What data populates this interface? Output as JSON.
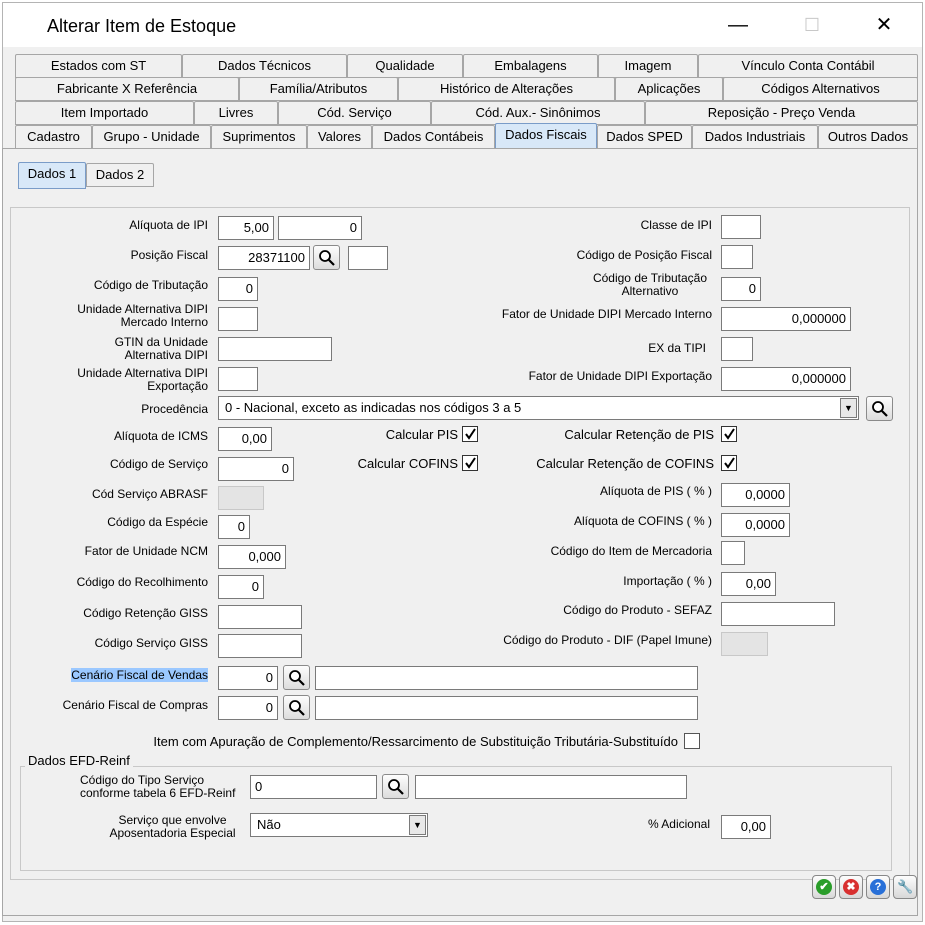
{
  "window": {
    "title": "Alterar Item de Estoque",
    "minimize": "—",
    "maximize": "☐",
    "close": "✕"
  },
  "tabs": {
    "row1": [
      "Estados com ST",
      "Dados Técnicos",
      "Qualidade",
      "Embalagens",
      "Imagem",
      "Vínculo Conta Contábil"
    ],
    "row2": [
      "Fabricante X Referência",
      "Família/Atributos",
      "Histórico de Alterações",
      "Aplicações",
      "Códigos Alternativos"
    ],
    "row3": [
      "Item Importado",
      "Livres",
      "Cód. Serviço",
      "Cód. Aux.- Sinônimos",
      "Reposição - Preço Venda"
    ],
    "row4": [
      "Cadastro",
      "Grupo - Unidade",
      "Suprimentos",
      "Valores",
      "Dados Contábeis",
      "Dados Fiscais",
      "Dados SPED",
      "Dados Industriais",
      "Outros Dados"
    ],
    "active": "Dados Fiscais"
  },
  "subtabs": [
    "Dados 1",
    "Dados 2"
  ],
  "form": {
    "aliquota_ipi": {
      "label": "Alíquota de IPI",
      "value1": "5,00",
      "value2": "0"
    },
    "classe_ipi": {
      "label": "Classe de IPI",
      "value": ""
    },
    "posicao_fiscal": {
      "label": "Posição Fiscal",
      "value": "28371100",
      "extra": ""
    },
    "codigo_posicao_fiscal": {
      "label": "Código de Posição Fiscal",
      "value": ""
    },
    "codigo_tributacao": {
      "label": "Código de Tributação",
      "value": "0"
    },
    "codigo_tributacao_alt": {
      "label": "Código de Tributação Alternativo",
      "value": "0"
    },
    "unidade_alt_dipi_mi": {
      "label": "Unidade Alternativa DIPI Mercado Interno",
      "value": ""
    },
    "fator_unidade_dipi_mi": {
      "label": "Fator de Unidade DIPI Mercado Interno",
      "value": "0,000000"
    },
    "gtin_unidade_alt": {
      "label": "GTIN da Unidade Alternativa DIPI",
      "value": ""
    },
    "ex_tipi": {
      "label": "EX da TIPI",
      "value": ""
    },
    "unidade_alt_dipi_exp": {
      "label": "Unidade Alternativa DIPI Exportação",
      "value": ""
    },
    "fator_unidade_dipi_exp": {
      "label": "Fator de Unidade DIPI Exportação",
      "value": "0,000000"
    },
    "procedencia": {
      "label": "Procedência",
      "value": "0 - Nacional, exceto as indicadas nos códigos 3 a 5"
    },
    "aliquota_icms": {
      "label": "Alíquota de ICMS",
      "value": "0,00"
    },
    "calcular_pis": {
      "label": "Calcular PIS",
      "checked": true
    },
    "calcular_retencao_pis": {
      "label": "Calcular Retenção de PIS",
      "checked": true
    },
    "codigo_servico": {
      "label": "Código de Serviço",
      "value": "0"
    },
    "calcular_cofins": {
      "label": "Calcular COFINS",
      "checked": true
    },
    "calcular_retencao_cofins": {
      "label": "Calcular Retenção de COFINS",
      "checked": true
    },
    "cod_servico_abrasf": {
      "label": "Cód Serviço ABRASF",
      "value": ""
    },
    "aliquota_pis": {
      "label": "Alíquota de PIS   ( % )",
      "value": "0,0000"
    },
    "codigo_especie": {
      "label": "Código da Espécie",
      "value": "0"
    },
    "aliquota_cofins": {
      "label": "Alíquota de COFINS ( % )",
      "value": "0,0000"
    },
    "fator_unidade_ncm": {
      "label": "Fator de Unidade NCM",
      "value": "0,000"
    },
    "codigo_item_mercadoria": {
      "label": "Código do Item de Mercadoria",
      "value": ""
    },
    "codigo_recolhimento": {
      "label": "Código do Recolhimento",
      "value": "0"
    },
    "importacao": {
      "label": "Importação ( % )",
      "value": "0,00"
    },
    "codigo_retencao_giss": {
      "label": "Código Retenção GISS",
      "value": ""
    },
    "codigo_produto_sefaz": {
      "label": "Código do Produto - SEFAZ",
      "value": ""
    },
    "codigo_servico_giss": {
      "label": "Código Serviço GISS",
      "value": ""
    },
    "codigo_produto_dif": {
      "label": "Código do Produto - DIF (Papel Imune)",
      "value": ""
    },
    "cenario_vendas": {
      "label": "Cenário Fiscal de Vendas",
      "value": "0",
      "desc": ""
    },
    "cenario_compras": {
      "label": "Cenário Fiscal de Compras",
      "value": "0",
      "desc": ""
    },
    "item_apuracao": {
      "label": "Item com Apuração de Complemento/Ressarcimento de Substituição Tributária-Substituído",
      "checked": false
    }
  },
  "efd_reinf": {
    "title": "Dados EFD-Reinf",
    "codigo_tipo_servico": {
      "label": "Código do Tipo Serviço conforme tabela 6 EFD-Reinf",
      "value": "0",
      "desc": ""
    },
    "servico_aposentadoria": {
      "label": "Serviço que envolve Aposentadoria Especial",
      "value": "Não"
    },
    "adicional": {
      "label": "% Adicional",
      "value": "0,00"
    }
  },
  "actions": {
    "ok": "✔",
    "cancel": "✖",
    "help": "?",
    "tools": "🔧"
  },
  "colors": {
    "active_tab": "#d8e8f8",
    "highlight": "#9bc8ff",
    "ok": "#2a9d2a",
    "cancel": "#d83030",
    "help": "#2870d8",
    "tools": "#e08020"
  }
}
